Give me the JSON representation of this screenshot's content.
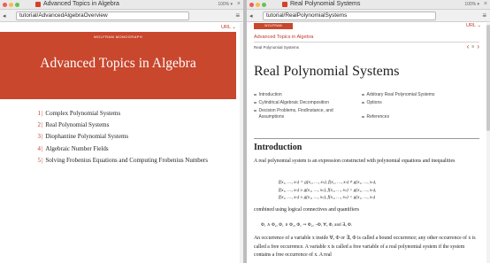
{
  "left": {
    "tab_title": "Advanced Topics in Algebra",
    "zoom": "100% ▾",
    "url": "tutorial/AdvancedAlgebraOverview",
    "url_link": "URL",
    "monograph": "WOLFRAM MONOGRAPH",
    "book_title": "Advanced Topics in Algebra",
    "toc": [
      {
        "num": "1",
        "label": "Complex Polynomial Systems"
      },
      {
        "num": "2",
        "label": "Real Polynomial Systems"
      },
      {
        "num": "3",
        "label": "Diophantine Polynomial Systems"
      },
      {
        "num": "4",
        "label": "Algebraic Number Fields"
      },
      {
        "num": "5",
        "label": "Solving Frobenius Equations and Computing Frobenius Numbers"
      }
    ]
  },
  "right": {
    "tab_title": "Real Polynomial Systems",
    "zoom": "100% ▾",
    "url": "tutorial/RealPolynomialSystems",
    "url_link": "URL",
    "monograph": "WOLFRAM MONOGRAPH",
    "book_title": "Advanced Topics in Algebra",
    "breadcrumb": "Real Polynomial Systems",
    "page_title": "Real Polynomial Systems",
    "sections_left": [
      "Introduction",
      "Cylindrical Algebraic Decomposition",
      "Decision Problems, FindInstance, and",
      "Assumptions"
    ],
    "sections_right": [
      "Arbitrary Real Polynomial Systems",
      "Options",
      "References"
    ],
    "intro_heading": "Introduction",
    "para1": "A real polynomial system is an expression constructed with polynomial equations and inequalities",
    "formula": [
      "f(x₁, …, xₙ) = g(x₁, …, xₙ), f(x₁, …, xₙ) ≠ g(x₁, …, xₙ),",
      "f(x₁, …, xₙ) ≥ g(x₁, …, xₙ), f(x₁, …, xₙ) > g(x₁, …, xₙ),",
      "f(x₁, …, xₙ) ≤ g(x₁, …, xₙ), f(x₁, …, xₙ) < g(x₁, …, xₙ)"
    ],
    "para2": "combined using logical connectives and quantifiers",
    "connectives": "Φ₁ ∧ Φ₂, Φ₁ ∨ Φ₂, Φ₁ ⇒ Φ₂, ¬Φ, ∀ₓ Φ, and ∃ₓ Φ.",
    "para3": "An occurrence of a variable x inside ∀ₓ Φ or ∃ₓ Φ is called a bound occurrence; any other occurrence of x is called a free occurrence. A variable x is called a free variable of a real polynomial system if the system contains a free occurrence of x. A real"
  }
}
